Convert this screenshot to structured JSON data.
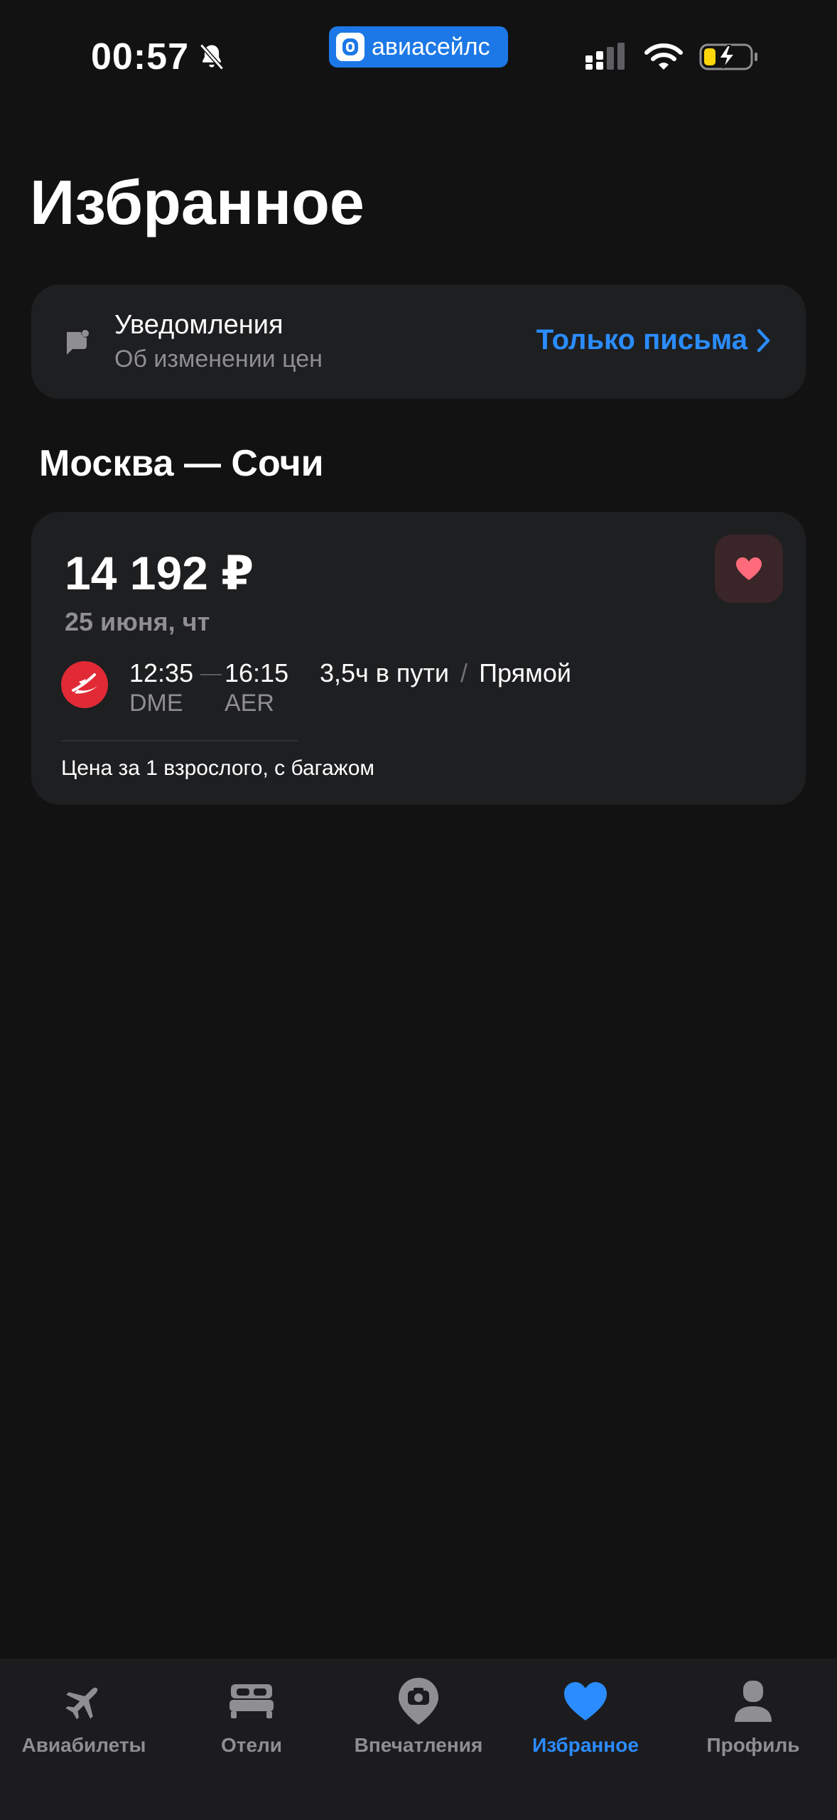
{
  "status_bar": {
    "time": "00:57",
    "brand": "авиасейлс"
  },
  "page": {
    "title": "Избранное"
  },
  "notifications": {
    "title": "Уведомления",
    "subtitle": "Об изменении цен",
    "action": "Только письма"
  },
  "route": {
    "title": "Москва — Сочи"
  },
  "ticket": {
    "price": "14 192 ₽",
    "date": "25 июня, чт",
    "departure_time": "12:35",
    "arrival_time": "16:15",
    "departure_code": "DME",
    "arrival_code": "AER",
    "duration": "3,5ч в пути",
    "separator": "/",
    "stops": "Прямой",
    "note": "Цена за 1 взрослого, с багажом"
  },
  "tabs": [
    {
      "label": "Авиабилеты",
      "icon": "plane-icon"
    },
    {
      "label": "Отели",
      "icon": "bed-icon"
    },
    {
      "label": "Впечатления",
      "icon": "location-camera-icon"
    },
    {
      "label": "Избранное",
      "icon": "heart-icon",
      "active": true
    },
    {
      "label": "Профиль",
      "icon": "person-icon"
    }
  ],
  "colors": {
    "background": "#121212",
    "card": "#1e1f21",
    "accent": "#2b8cff",
    "brand": "#1c78e6",
    "favorite": "#ff6b7a",
    "airline": "#e12a36"
  }
}
